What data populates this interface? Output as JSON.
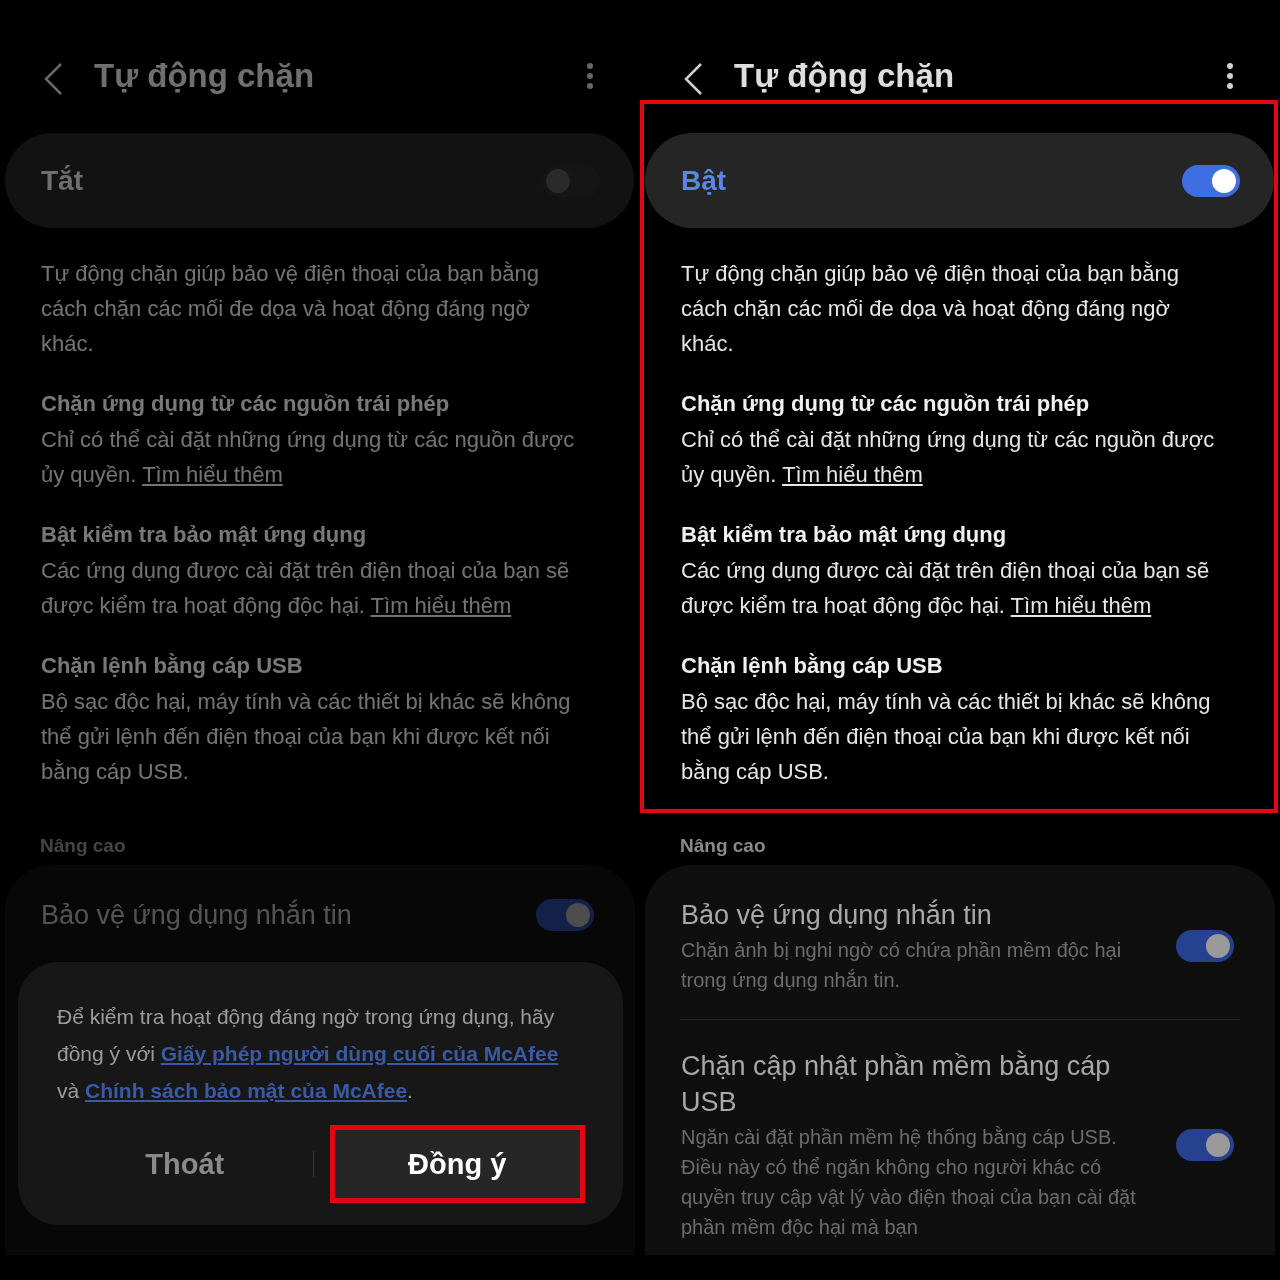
{
  "panels": [
    {
      "title": "Tự động chặn",
      "dimmed": true,
      "highlighted": false,
      "master": {
        "label": "Tắt",
        "on": false
      },
      "intro": "Tự động chặn giúp bảo vệ điện thoại của bạn bằng cách chặn các mối đe dọa và hoạt động đáng ngờ khác.",
      "sections": [
        {
          "heading": "Chặn ứng dụng từ các nguồn trái phép",
          "body": "Chỉ có thể cài đặt những ứng dụng từ các nguồn được ủy quyền.",
          "link": "Tìm hiểu thêm"
        },
        {
          "heading": "Bật kiểm tra bảo mật ứng dụng",
          "body": "Các ứng dụng được cài đặt trên điện thoại của bạn sẽ được kiểm tra hoạt động độc hại.",
          "link": "Tìm hiểu thêm"
        },
        {
          "heading": "Chặn lệnh bằng cáp USB",
          "body": "Bộ sạc độc hại, máy tính và các thiết bị khác sẽ không thể gửi lệnh đến điện thoại của bạn khi được kết nối bằng cáp USB."
        }
      ],
      "advanced_label": "Nâng cao",
      "advanced_items": [
        {
          "title": "Bảo vệ ứng dụng nhắn tin",
          "on": true
        }
      ],
      "dialog": {
        "message_parts": [
          {
            "kind": "text",
            "text": "Để kiểm tra hoạt động đáng ngờ trong ứng dụng, hãy đồng ý với "
          },
          {
            "kind": "link",
            "text": "Giấy phép người dùng cuối của McAfee"
          },
          {
            "kind": "text",
            "text": " và "
          },
          {
            "kind": "link",
            "text": "Chính sách bảo mật của McAfee"
          },
          {
            "kind": "text",
            "text": "."
          }
        ],
        "buttons": [
          {
            "label": "Thoát",
            "kind": "secondary",
            "highlighted": false
          },
          {
            "label": "Đồng ý",
            "kind": "primary",
            "highlighted": true
          }
        ]
      }
    },
    {
      "title": "Tự động chặn",
      "highlighted": true,
      "master": {
        "label": "Bật",
        "on": true
      },
      "intro": "Tự động chặn giúp bảo vệ điện thoại của bạn bằng cách chặn các mối đe dọa và hoạt động đáng ngờ khác.",
      "sections": [
        {
          "heading": "Chặn ứng dụng từ các nguồn trái phép",
          "body": "Chỉ có thể cài đặt những ứng dụng từ các nguồn được ủy quyền.",
          "link": "Tìm hiểu thêm"
        },
        {
          "heading": "Bật kiểm tra bảo mật ứng dụng",
          "body": "Các ứng dụng được cài đặt trên điện thoại của bạn sẽ được kiểm tra hoạt động độc hại.",
          "link": "Tìm hiểu thêm"
        },
        {
          "heading": "Chặn lệnh bằng cáp USB",
          "body": "Bộ sạc độc hại, máy tính và các thiết bị khác sẽ không thể gửi lệnh đến điện thoại của bạn khi được kết nối bằng cáp USB."
        }
      ],
      "advanced_label": "Nâng cao",
      "advanced_items": [
        {
          "title": "Bảo vệ ứng dụng nhắn tin",
          "desc": "Chặn ảnh bị nghi ngờ có chứa phần mềm độc hại trong ứng dụng nhắn tin.",
          "on": true
        },
        {
          "title": "Chặn cập nhật phần mềm bằng cáp USB",
          "desc": "Ngăn cài đặt phần mềm hệ thống bằng cáp USB. Điều này có thể ngăn không cho người khác có quyền truy cập vật lý vào điện thoại của bạn cài đặt phần mềm độc hại mà bạn",
          "on": true
        }
      ]
    }
  ]
}
